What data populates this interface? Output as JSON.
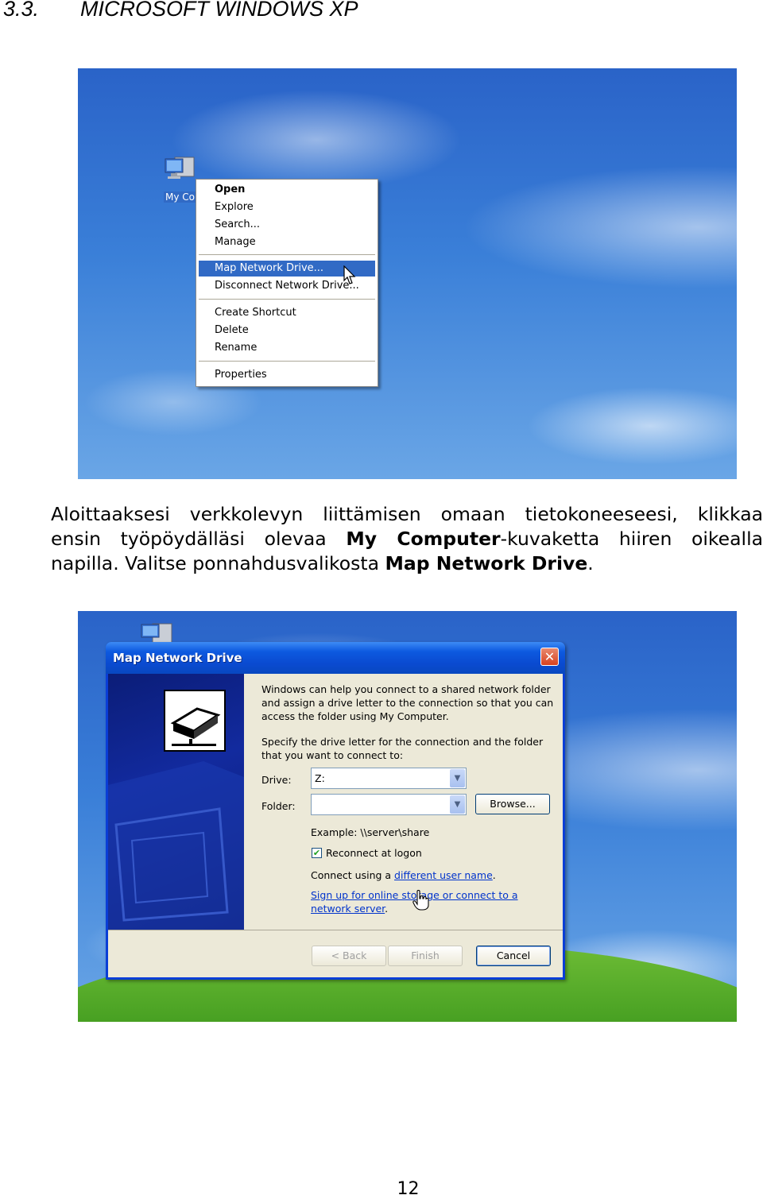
{
  "heading": {
    "number": "3.3.",
    "title": "MICROSOFT WINDOWS XP"
  },
  "screenshot1": {
    "desktop_icon_label": "My Co",
    "context_menu": {
      "items": [
        "Open",
        "Explore",
        "Search...",
        "Manage",
        "Map Network Drive...",
        "Disconnect Network Drive...",
        "Create Shortcut",
        "Delete",
        "Rename",
        "Properties"
      ],
      "selected": "Map Network Drive..."
    }
  },
  "paragraph": {
    "line1": "Aloittaaksesi verkkolevyn liittämisen omaan tietokoneeseesi, klikkaa",
    "line2_pre": "ensin työpöydälläsi olevaa ",
    "line2_bold": "My Computer",
    "line2_post": "-kuvaketta hiiren oikealla",
    "line3_pre": "napilla. Valitse ponnahdusvalikosta ",
    "line3_bold": "Map Network Drive",
    "line3_post": "."
  },
  "dialog": {
    "title": "Map Network Drive",
    "close_glyph": "✕",
    "intro_lines": [
      "Windows can help you connect to a shared network folder",
      "and assign a drive letter to the connection so that you can",
      "access the folder using My Computer."
    ],
    "specify_lines": [
      "Specify the drive letter for the connection and the folder",
      "that you want to connect to:"
    ],
    "drive_label": "Drive:",
    "drive_value": "Z:",
    "folder_label": "Folder:",
    "folder_value": "",
    "browse_label": "Browse...",
    "example": "Example: \\\\server\\share",
    "reconnect_label": "Reconnect at logon",
    "reconnect_checked": true,
    "connect_pre": "Connect using a ",
    "connect_link": "different user name",
    "connect_post": ".",
    "signup_line1": "Sign up for online storage or connect to a",
    "signup_line2": "network server",
    "signup_post": ".",
    "back_label": "< Back",
    "finish_label": "Finish",
    "cancel_label": "Cancel"
  },
  "page_number": "12"
}
